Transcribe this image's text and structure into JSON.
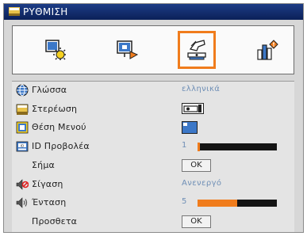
{
  "title": "ΡΥΘΜΙΣΗ",
  "toolbar": {
    "buttons": [
      {
        "icon": "image-settings-icon",
        "selected": false
      },
      {
        "icon": "display-settings-icon",
        "selected": false
      },
      {
        "icon": "setup-settings-icon",
        "selected": true
      },
      {
        "icon": "options-settings-icon",
        "selected": false
      }
    ]
  },
  "menu": {
    "language": {
      "label": "Γλώσσα",
      "value": "ελληνικά",
      "icon": "globe-icon"
    },
    "projection": {
      "label": "Στερέωση",
      "icon": "projector-icon",
      "value_icon": "front-desktop-projection-icon"
    },
    "menu_position": {
      "label": "Θέση Μενού",
      "icon": "menu-position-icon",
      "value_icon": "menu-position-topleft-icon"
    },
    "projector_id": {
      "label": "ID Προβολέα",
      "value": "1",
      "level": 0.02,
      "icon": "id-icon"
    },
    "signal": {
      "label": "Σήμα",
      "button": "OK"
    },
    "mute": {
      "label": "Σίγαση",
      "value": "Ανενεργό",
      "icon": "mute-icon"
    },
    "volume": {
      "label": "Ένταση",
      "value": "5",
      "level": 0.5,
      "icon": "speaker-icon"
    },
    "advanced": {
      "label": "Προσθετα",
      "button": "OK"
    }
  },
  "colors": {
    "accent": "#f07c1c",
    "title_bar": "#0b2058",
    "value_text": "#6f8fb6"
  }
}
